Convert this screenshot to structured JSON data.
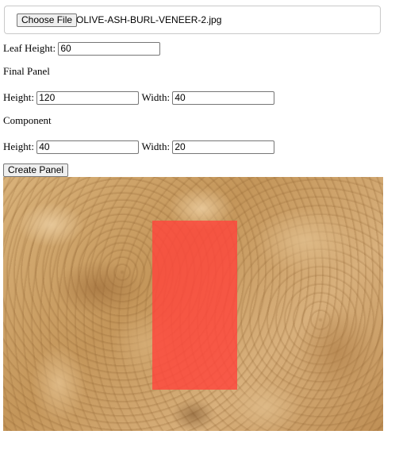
{
  "file_input": {
    "button_label": "Choose File",
    "file_name": "OLIVE-ASH-BURL-VENEER-2.jpg"
  },
  "leaf": {
    "label": "Leaf Height:",
    "value": "60"
  },
  "final_panel": {
    "heading": "Final Panel",
    "height_label": "Height:",
    "height_value": "120",
    "width_label": "Width:",
    "width_value": "40"
  },
  "component": {
    "heading": "Component",
    "height_label": "Height:",
    "height_value": "40",
    "width_label": "Width:",
    "width_value": "20"
  },
  "actions": {
    "create_label": "Create Panel"
  },
  "preview": {
    "texture": "olive-ash-burl-veneer",
    "overlay_color": "#ff463c"
  }
}
